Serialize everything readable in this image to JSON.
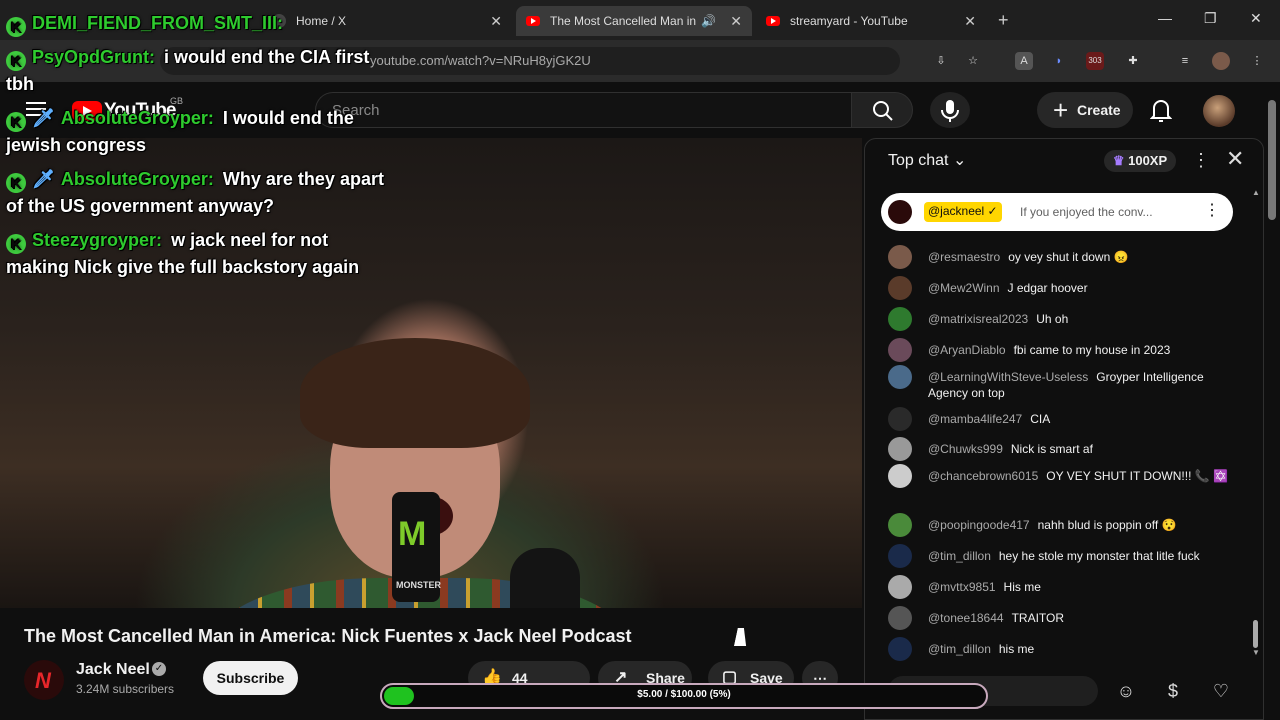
{
  "browser": {
    "tabs": [
      {
        "label": "Home / X"
      },
      {
        "label": "The Most Cancelled Man in"
      },
      {
        "label": "streamyard - YouTube"
      }
    ],
    "url": "youtube.com/watch?v=NRuH8yjGK2U",
    "ext_badge": "303"
  },
  "youtube": {
    "logo": "YouTube",
    "region": "GB",
    "search_placeholder": "Search",
    "create_label": "Create"
  },
  "overlay_chat": [
    {
      "name": "DEMI_FIEND_FROM_SMT_III:",
      "text": ""
    },
    {
      "name": "PsyOpdGrunt:",
      "text": "i would end the CIA first tbh"
    },
    {
      "name": "AbsoluteGroyper:",
      "text": "I would end the jewish congress"
    },
    {
      "name": "AbsoluteGroyper:",
      "text": "Why are they apart of the US government anyway?"
    },
    {
      "name": "Steezygroyper:",
      "text": "w jack neel for not making Nick give the full backstory again"
    }
  ],
  "video": {
    "title": "The Most Cancelled Man in America: Nick Fuentes x Jack Neel Podcast",
    "channel": "Jack Neel",
    "subscribers": "3.24M subscribers",
    "subscribe_label": "Subscribe",
    "likes": "44",
    "share_label": "Share",
    "save_label": "Save",
    "can_text": "MONSTER"
  },
  "goal": {
    "text": "$5.00 / $100.00 (5%)",
    "fraction": 0.05
  },
  "live_chat": {
    "header": "Top chat",
    "xp": "100XP",
    "pinned": {
      "author": "@jackneel",
      "text": "If you enjoyed the conv..."
    },
    "messages": [
      {
        "author": "@resmaestro",
        "text": "oy vey shut it down 😠"
      },
      {
        "author": "@Mew2Winn",
        "text": "J edgar hoover"
      },
      {
        "author": "@matrixisreal2023",
        "text": "Uh oh"
      },
      {
        "author": "@AryanDiablo",
        "text": "fbi came to my house in 2023"
      },
      {
        "author": "@LearningWithSteve-Useless",
        "text": "Groyper Intelligence Agency on top"
      },
      {
        "author": "@mamba4life247",
        "text": "CIA"
      },
      {
        "author": "@Chuwks999",
        "text": "Nick is smart af"
      },
      {
        "author": "@chancebrown6015",
        "text": "OY VEY SHUT IT DOWN!!! 📞 ✡️"
      },
      {
        "author": "@poopingoode417",
        "text": "nahh blud is poppin off 😯"
      },
      {
        "author": "@tim_dillon",
        "text": "hey he stole my monster that litle fuck"
      },
      {
        "author": "@mvttx9851",
        "text": "His me"
      },
      {
        "author": "@tonee18644",
        "text": "TRAITOR"
      },
      {
        "author": "@tim_dillon",
        "text": "his me"
      }
    ]
  }
}
